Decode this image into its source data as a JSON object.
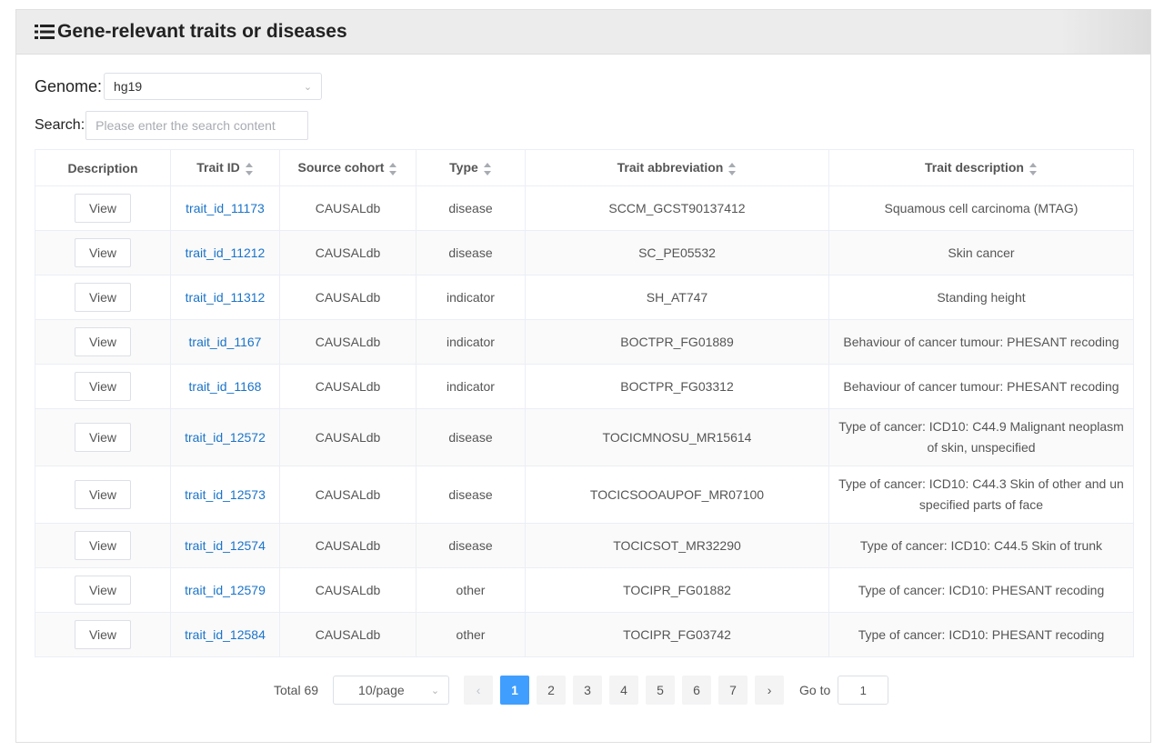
{
  "panel": {
    "title": "Gene-relevant traits or diseases"
  },
  "genome": {
    "label": "Genome:",
    "value": "hg19"
  },
  "search": {
    "label": "Search:",
    "placeholder": "Please enter the search content"
  },
  "table": {
    "headers": [
      "Description",
      "Trait ID",
      "Source cohort",
      "Type",
      "Trait abbreviation",
      "Trait description"
    ],
    "rows": [
      {
        "action": "View",
        "trait_id": "trait_id_11173",
        "source": "CAUSALdb",
        "type": "disease",
        "abbrev": "SCCM_GCST90137412",
        "desc": "Squamous cell carcinoma (MTAG)"
      },
      {
        "action": "View",
        "trait_id": "trait_id_11212",
        "source": "CAUSALdb",
        "type": "disease",
        "abbrev": "SC_PE05532",
        "desc": "Skin cancer"
      },
      {
        "action": "View",
        "trait_id": "trait_id_11312",
        "source": "CAUSALdb",
        "type": "indicator",
        "abbrev": "SH_AT747",
        "desc": "Standing height"
      },
      {
        "action": "View",
        "trait_id": "trait_id_1167",
        "source": "CAUSALdb",
        "type": "indicator",
        "abbrev": "BOCTPR_FG01889",
        "desc": "Behaviour of cancer tumour: PHESANT recoding"
      },
      {
        "action": "View",
        "trait_id": "trait_id_1168",
        "source": "CAUSALdb",
        "type": "indicator",
        "abbrev": "BOCTPR_FG03312",
        "desc": "Behaviour of cancer tumour: PHESANT recoding"
      },
      {
        "action": "View",
        "trait_id": "trait_id_12572",
        "source": "CAUSALdb",
        "type": "disease",
        "abbrev": "TOCICMNOSU_MR15614",
        "desc": "Type of cancer: ICD10: C44.9 Malignant neoplasm of skin, unspecified"
      },
      {
        "action": "View",
        "trait_id": "trait_id_12573",
        "source": "CAUSALdb",
        "type": "disease",
        "abbrev": "TOCICSOOAUPOF_MR07100",
        "desc": "Type of cancer: ICD10: C44.3 Skin of other and unspecified parts of face"
      },
      {
        "action": "View",
        "trait_id": "trait_id_12574",
        "source": "CAUSALdb",
        "type": "disease",
        "abbrev": "TOCICSOT_MR32290",
        "desc": "Type of cancer: ICD10: C44.5 Skin of trunk"
      },
      {
        "action": "View",
        "trait_id": "trait_id_12579",
        "source": "CAUSALdb",
        "type": "other",
        "abbrev": "TOCIPR_FG01882",
        "desc": "Type of cancer: ICD10: PHESANT recoding"
      },
      {
        "action": "View",
        "trait_id": "trait_id_12584",
        "source": "CAUSALdb",
        "type": "other",
        "abbrev": "TOCIPR_FG03742",
        "desc": "Type of cancer: ICD10: PHESANT recoding"
      }
    ]
  },
  "pagination": {
    "total": "Total 69",
    "page_size": "10/page",
    "prev": "‹",
    "pages": [
      "1",
      "2",
      "3",
      "4",
      "5",
      "6",
      "7"
    ],
    "next": "›",
    "goto_label": "Go to",
    "goto_value": "1"
  },
  "colors": {
    "accent": "#409eff",
    "link": "#1a73c9"
  },
  "icons": {
    "title": "list-icon",
    "sort": "sort-caret-icon",
    "dropdown": "chevron-down-icon"
  }
}
